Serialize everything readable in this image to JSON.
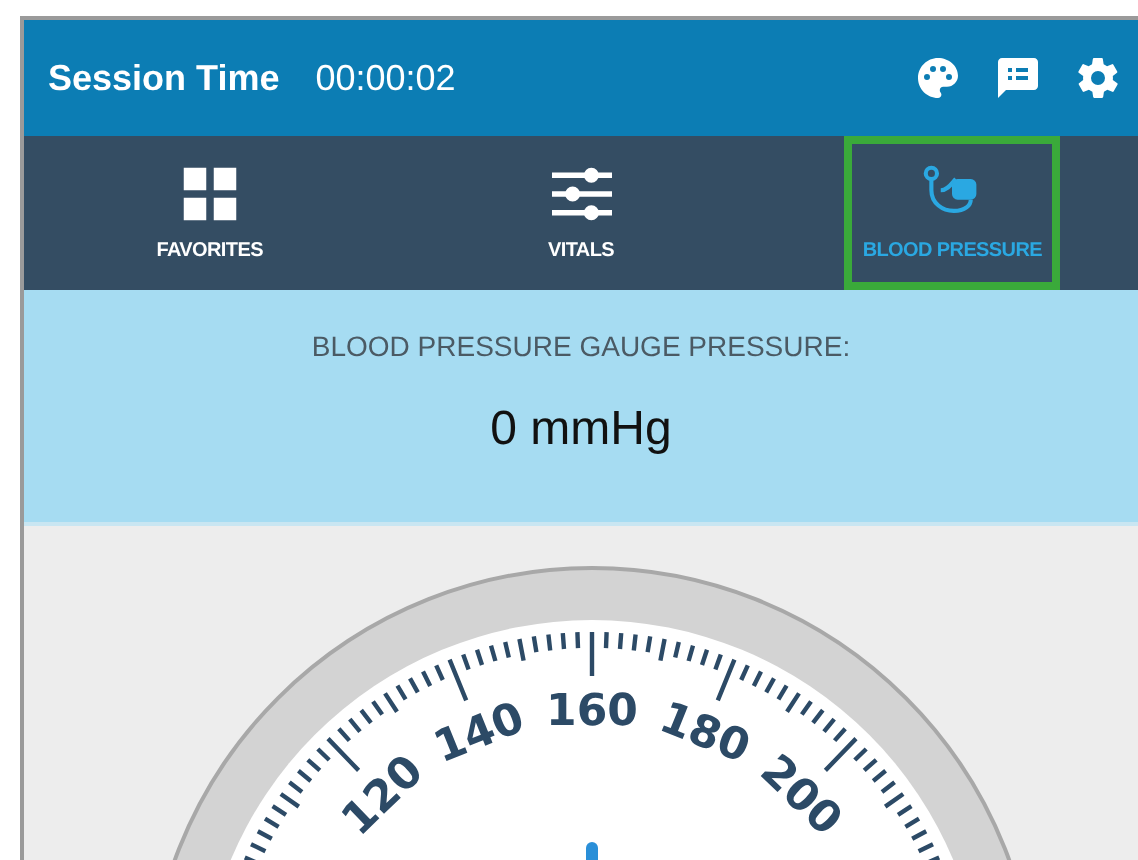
{
  "header": {
    "title": "Session Time",
    "timer": "00:00:02"
  },
  "tabs": [
    {
      "label": "FAVORITES",
      "kind": "grid",
      "selected": false
    },
    {
      "label": "VITALS",
      "kind": "sliders",
      "selected": false
    },
    {
      "label": "BLOOD PRESSURE",
      "kind": "cuff",
      "selected": true
    }
  ],
  "pressure_panel": {
    "caption": "BLOOD PRESSURE GAUGE PRESSURE:",
    "reading": "0 mmHg"
  },
  "gauge": {
    "labels": [
      "120",
      "140",
      "160",
      "180",
      "200"
    ]
  }
}
